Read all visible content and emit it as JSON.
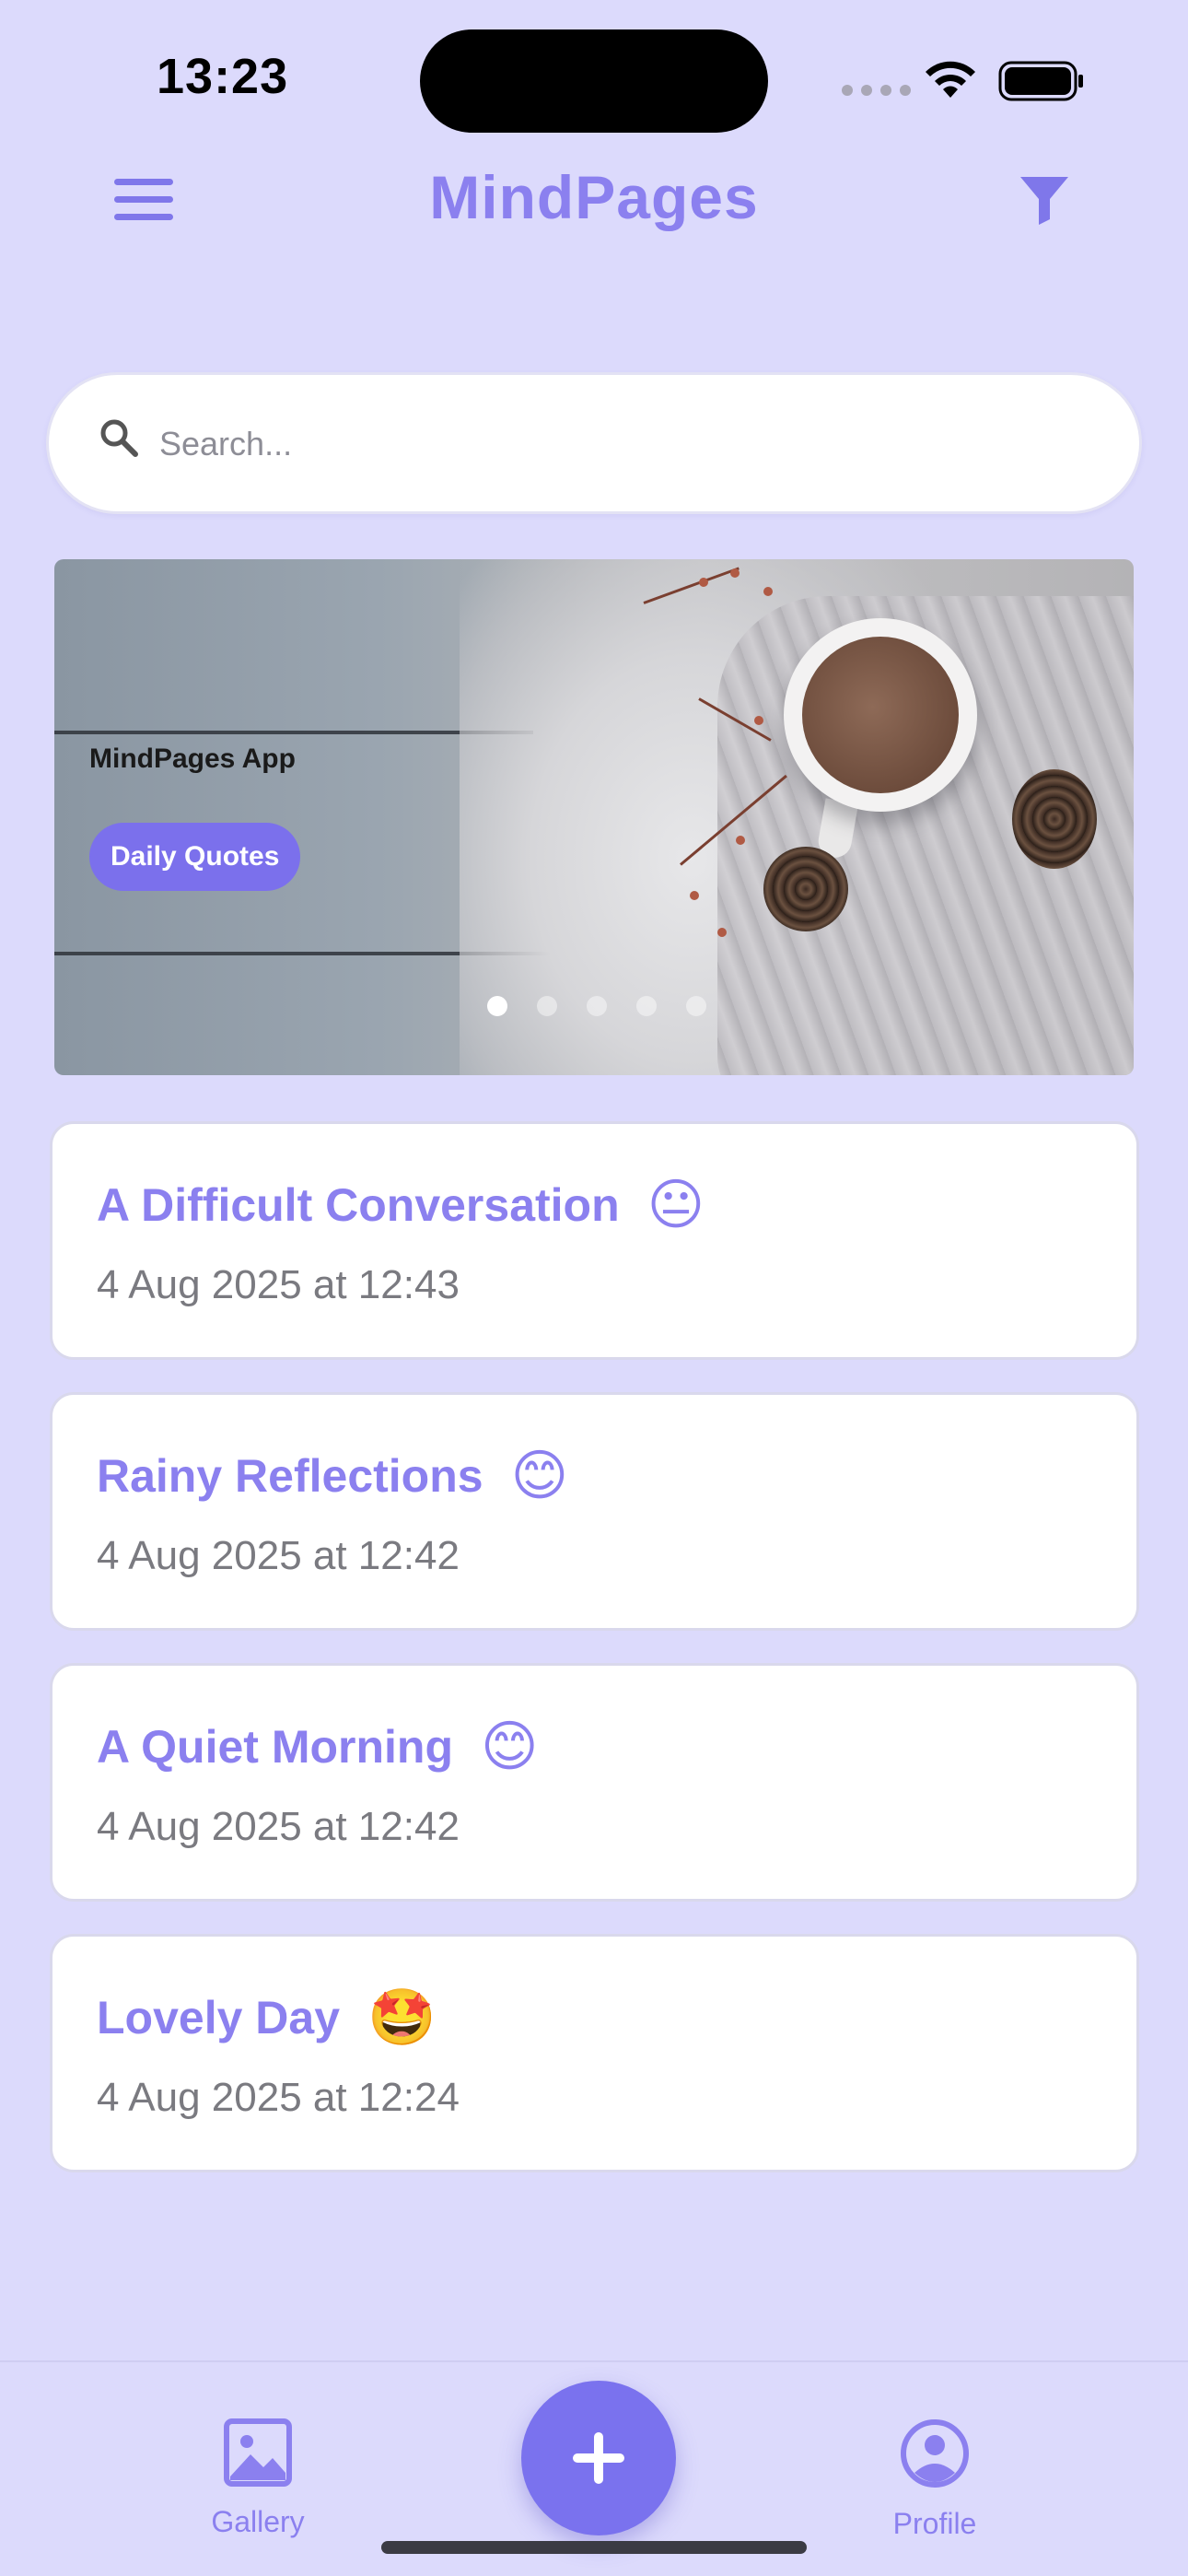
{
  "status_bar": {
    "time": "13:23"
  },
  "header": {
    "title": "MindPages"
  },
  "search": {
    "placeholder": "Search..."
  },
  "carousel": {
    "caption": "MindPages App",
    "pill_label": "Daily Quotes",
    "slide_count": 5,
    "active_slide": 1
  },
  "entries": [
    {
      "title": "A Difficult Conversation",
      "emoji": "😐",
      "date": "4 Aug 2025 at 12:43"
    },
    {
      "title": "Rainy Reflections",
      "emoji": "😊",
      "date": "4 Aug 2025 at 12:42"
    },
    {
      "title": "A Quiet Morning",
      "emoji": "😊",
      "date": "4 Aug 2025 at 12:42"
    },
    {
      "title": "Lovely Day",
      "emoji": "🤩",
      "date": "4 Aug 2025 at 12:24"
    }
  ],
  "bottom_nav": {
    "gallery_label": "Gallery",
    "profile_label": "Profile",
    "add_icon": "plus-icon"
  },
  "colors": {
    "background": "#dcdafc",
    "accent": "#8b80ef",
    "fab": "#7a72ee",
    "card": "#ffffff",
    "date_text": "#7a7a80"
  }
}
